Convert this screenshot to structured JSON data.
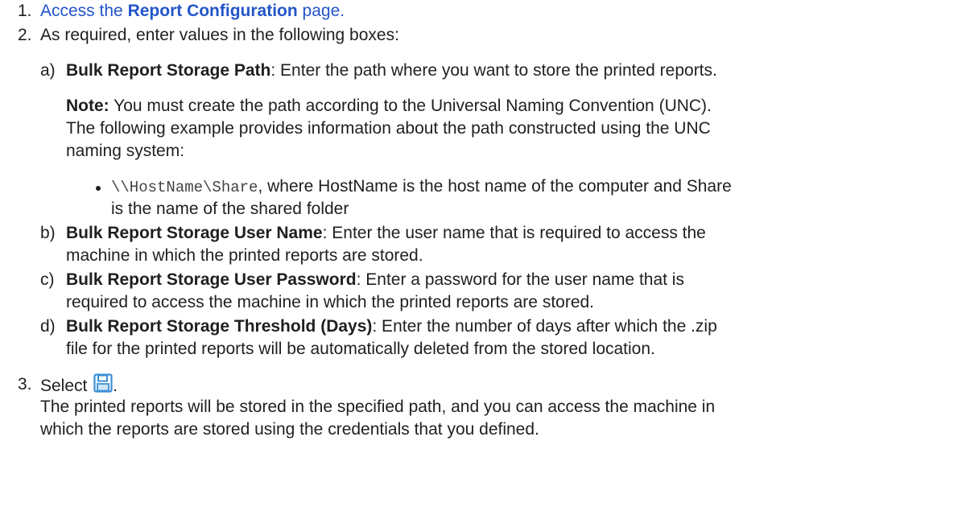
{
  "steps": [
    {
      "number": "1.",
      "pre": "Access the ",
      "link_bold": "Report Configuration",
      "post": " page."
    },
    {
      "number": "2.",
      "text": "As required, enter values in the following boxes:",
      "substeps": [
        {
          "letter": "a)",
          "term": "Bulk Report Storage Path",
          "desc": ": Enter the path where you want to store the printed reports.",
          "note_label": "Note:",
          "note_line1": " You must create the path according to the Universal Naming Convention (UNC).",
          "note_line2": "The following example provides information about the path constructed using the UNC",
          "note_line3": "naming system:",
          "example_code": "\\\\HostName\\Share",
          "example_line1": ", where HostName is the host name of the computer and Share",
          "example_line2": "is the name of the shared folder"
        },
        {
          "letter": "b)",
          "term": "Bulk Report Storage User Name",
          "desc_line1": ": Enter the user name that is required to access the",
          "desc_line2": "machine in which the printed reports are stored."
        },
        {
          "letter": "c)",
          "term": "Bulk Report Storage User Password",
          "desc_line1": ": Enter a password for the user name that is",
          "desc_line2": "required to access the machine in which the printed reports are stored."
        },
        {
          "letter": "d)",
          "term": "Bulk Report Storage Threshold (Days)",
          "desc_line1": ": Enter the number of days after which the .zip",
          "desc_line2": "file for the printed reports will be automatically deleted from the stored location."
        }
      ]
    },
    {
      "number": "3.",
      "text": "Select ",
      "text_after": ".",
      "icon": "save-icon",
      "result_line1": "The printed reports will be stored in the specified path, and you can access the machine in",
      "result_line2": "which the reports are stored using the credentials that you defined."
    }
  ],
  "colors": {
    "link": "#2255c9",
    "text": "#1f1f1f",
    "icon": "#3a8fd8"
  }
}
